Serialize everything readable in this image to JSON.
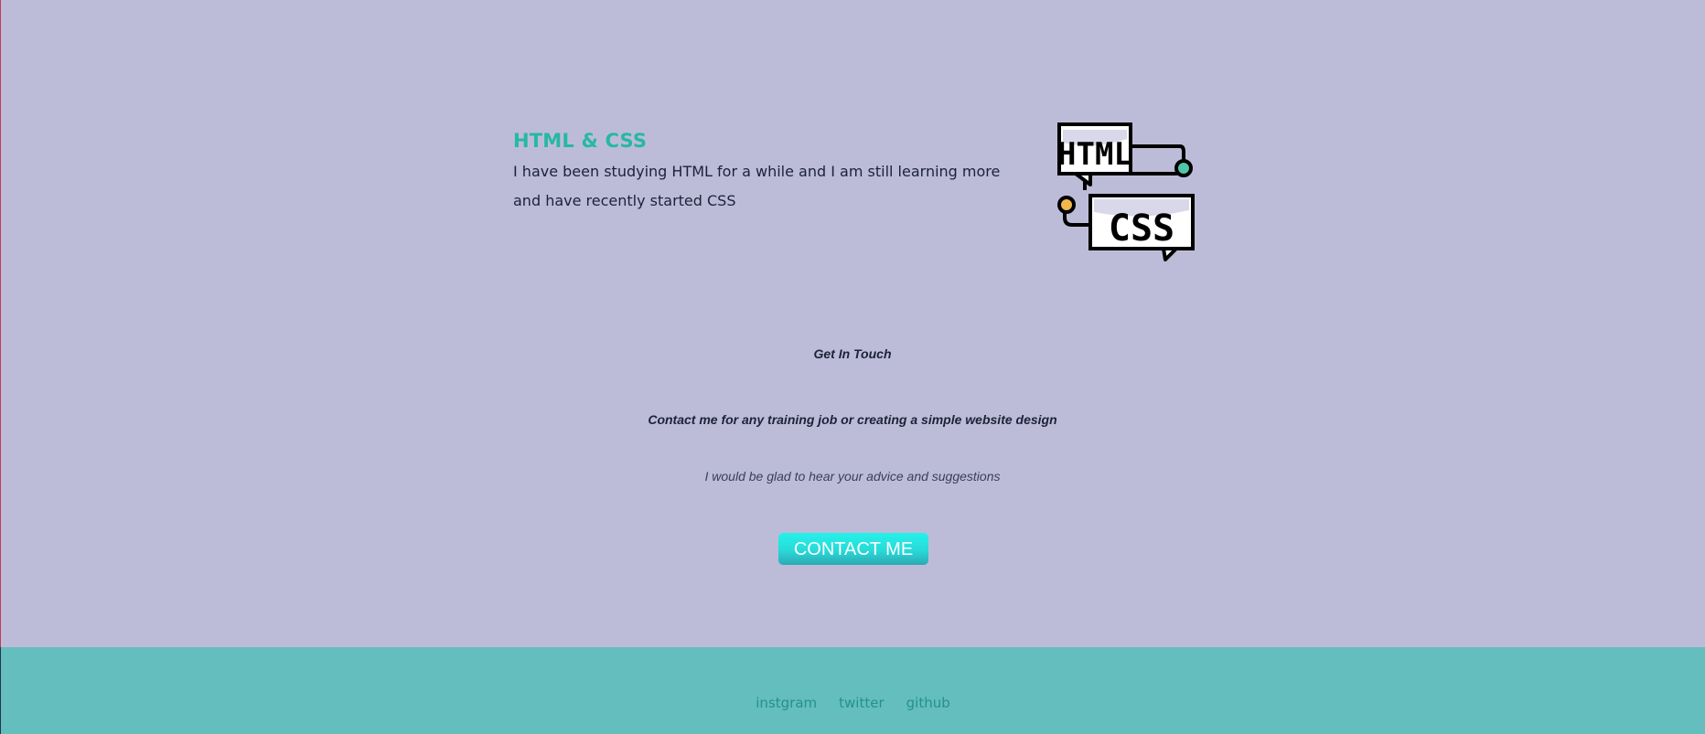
{
  "skill": {
    "title": "HTML & CSS",
    "description": "I have been studying HTML for a while and I am still learning more and have recently started CSS",
    "image": {
      "icon": "html-css-icon",
      "html_text": "HTML",
      "css_text": "CSS"
    }
  },
  "contact": {
    "heading": "Get In Touch",
    "subheading": "Contact me for any training job or creating a simple website design",
    "note": "I would be glad to hear your advice and suggestions",
    "button_label": "CONTACT ME"
  },
  "footer": {
    "links": [
      "instgram",
      "twitter",
      "github"
    ]
  },
  "colors": {
    "background": "#bdbcd8",
    "accent": "#27b8a2",
    "footer": "#64bebd",
    "button": "#28dad8"
  }
}
